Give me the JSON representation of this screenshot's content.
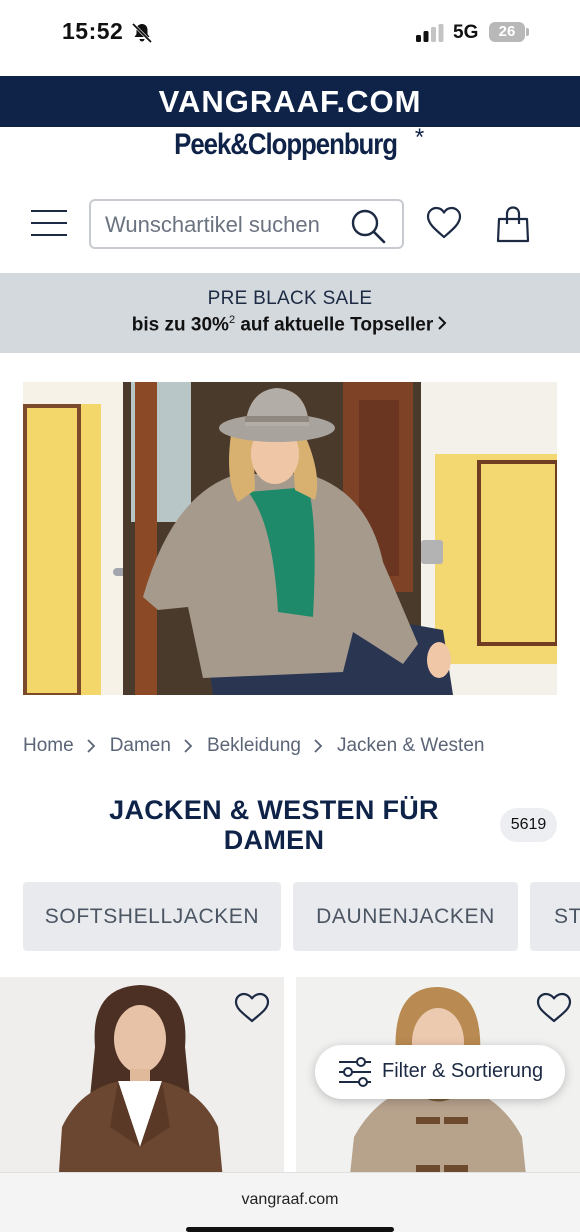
{
  "status_bar": {
    "time": "15:52",
    "network": "5G",
    "battery": "26"
  },
  "brand": {
    "site": "VANGRAAF.COM",
    "logo_text": "Peek&Cloppenburg",
    "logo_star": "*"
  },
  "header": {
    "search_placeholder": "Wunschartikel suchen"
  },
  "promo": {
    "line1": "PRE BLACK SALE",
    "line2_main": "bis zu 30%",
    "line2_sup": "2",
    "line2_rest": " auf aktuelle Topseller"
  },
  "breadcrumb": [
    "Home",
    "Damen",
    "Bekleidung",
    "Jacken & Westen"
  ],
  "page": {
    "title": "JACKEN & WESTEN FÜR DAMEN",
    "count": "5619"
  },
  "chips": [
    "SOFTSHELLJACKEN",
    "DAUNENJACKEN",
    "STEPPJACKEN"
  ],
  "filter": {
    "label": "Filter & Sortierung"
  },
  "browser": {
    "url": "vangraaf.com"
  },
  "colors": {
    "navy": "#0f2348",
    "promo_bg": "#d4d9de",
    "chip_bg": "#e8eaed"
  }
}
